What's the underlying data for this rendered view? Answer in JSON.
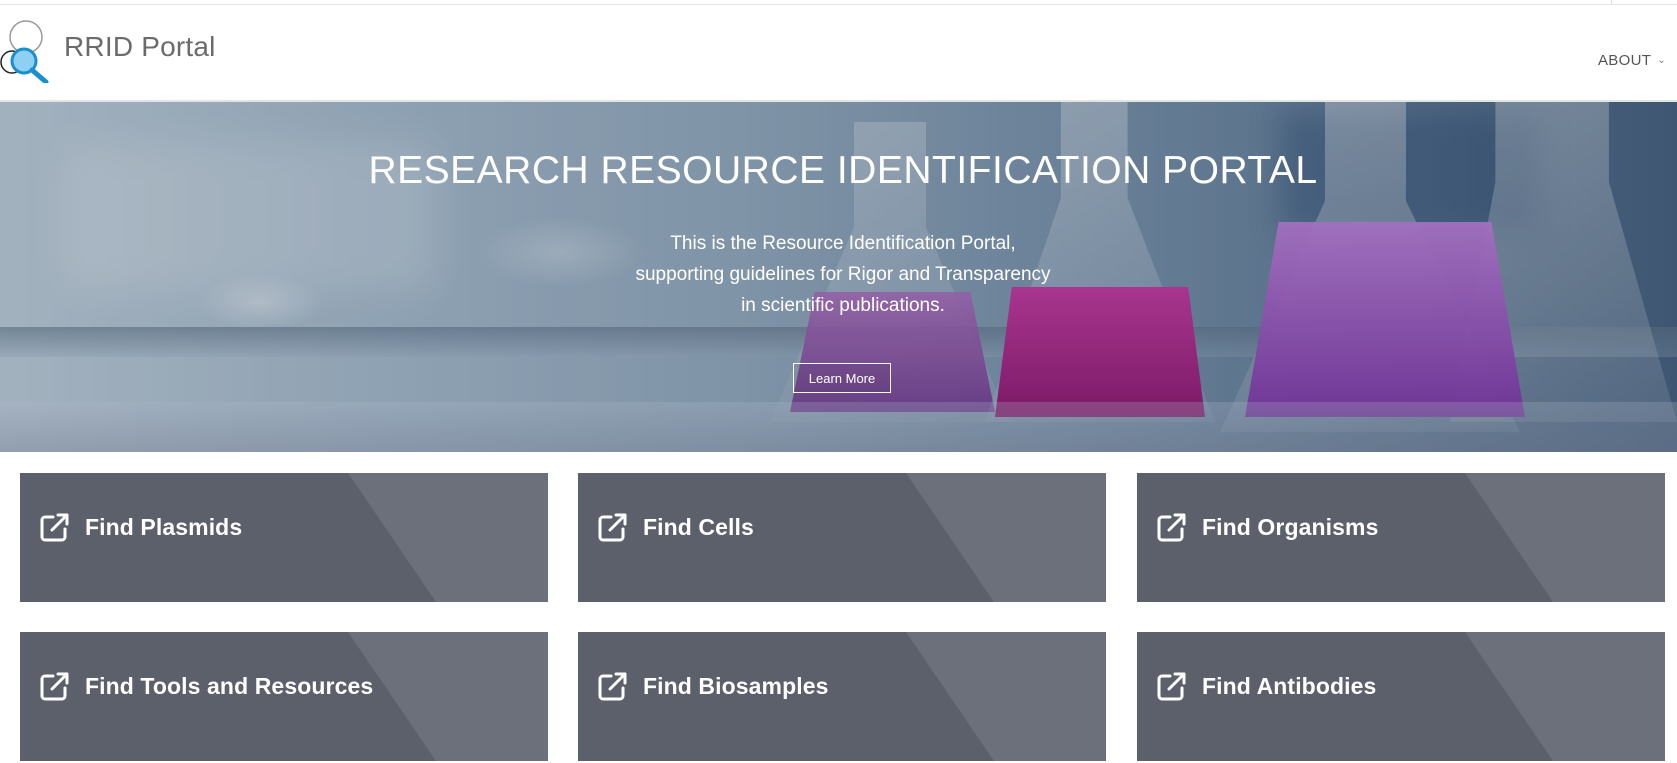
{
  "header": {
    "brand": "RRID Portal",
    "nav_about": "ABOUT"
  },
  "hero": {
    "title": "RESEARCH RESOURCE IDENTIFICATION PORTAL",
    "lines": [
      "This is the Resource Identification Portal,",
      "supporting guidelines for Rigor and Transparency",
      "in scientific publications."
    ],
    "button": "Learn More"
  },
  "tiles": [
    {
      "label": "Find Plasmids",
      "icon": "external-link-icon"
    },
    {
      "label": "Find Cells",
      "icon": "external-link-icon"
    },
    {
      "label": "Find Organisms",
      "icon": "external-link-icon"
    },
    {
      "label": "Find Tools and Resources",
      "icon": "external-link-icon"
    },
    {
      "label": "Find Biosamples",
      "icon": "external-link-icon"
    },
    {
      "label": "Find Antibodies",
      "icon": "external-link-icon"
    }
  ],
  "colors": {
    "tile_bg": "#5b606b",
    "tile_stripe": "#6b707b",
    "brand_text": "#6b6b6b"
  }
}
